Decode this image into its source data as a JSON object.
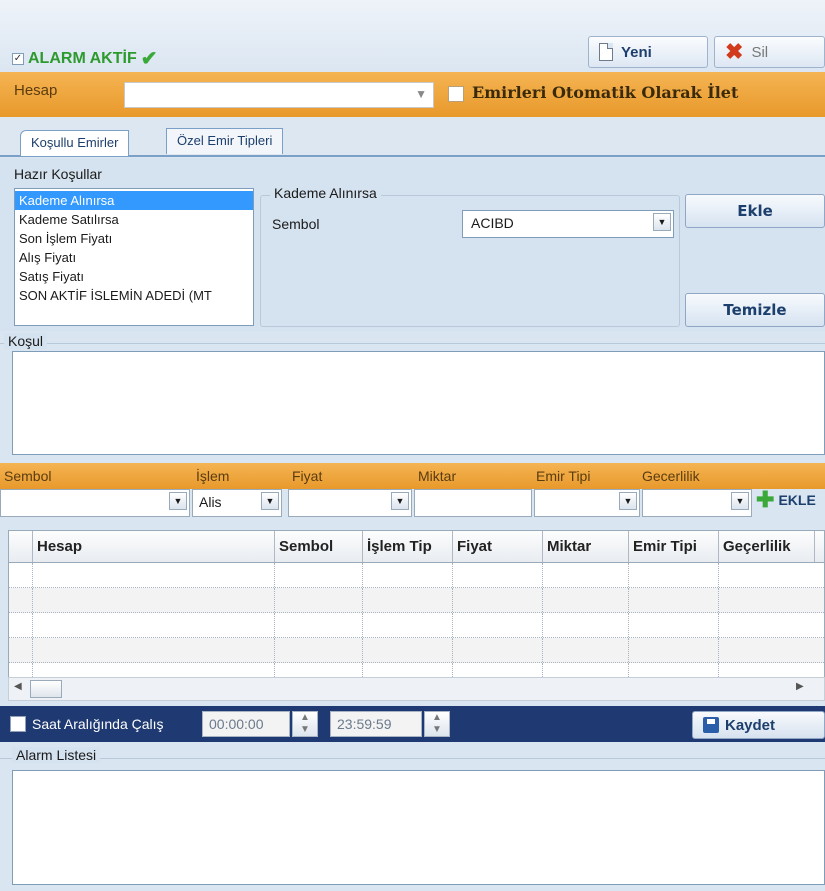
{
  "header": {
    "alarm_check": "✓",
    "alarm_label": "ALARM AKTİF",
    "alarm_tick": "✔",
    "new_label": "Yeni",
    "delete_label": "Sil"
  },
  "account": {
    "label": "Hesap",
    "value": "",
    "auto_send_label": "Emirleri Otomatik Olarak İlet"
  },
  "tabs": [
    {
      "label": "Koşullu Emirler"
    },
    {
      "label": "Özel Emir Tipleri"
    }
  ],
  "conditions": {
    "title": "Hazır Koşullar",
    "items": [
      {
        "label": "Kademe Alınırsa"
      },
      {
        "label": "Kademe Satılırsa"
      },
      {
        "label": "Son İşlem Fiyatı"
      },
      {
        "label": "Alış Fiyatı"
      },
      {
        "label": "Satış Fiyatı"
      },
      {
        "label": "SON AKTİF İSLEMİN ADEDİ (MT"
      }
    ],
    "group_title": "Kademe Alınırsa",
    "symbol_label": "Sembol",
    "symbol_value": "ACIBD",
    "add_label": "Ekle",
    "clear_label": "Temizle"
  },
  "condition_box": {
    "label": "Koşul"
  },
  "order": {
    "labels": [
      "Sembol",
      "İşlem",
      "Fiyat",
      "Miktar",
      "Emir Tipi",
      "Gecerlilik"
    ],
    "islem_value": "Alis",
    "add_label": "EKLE"
  },
  "grid": {
    "columns": [
      "Hesap",
      "Sembol",
      "İşlem Tip",
      "Fiyat",
      "Miktar",
      "Emir Tipi",
      "Geçerlilik"
    ]
  },
  "time": {
    "label": "Saat Aralığında Çalış",
    "start": "00:00:00",
    "end": "23:59:59",
    "save_label": "Kaydet"
  },
  "alarm_list": {
    "label": "Alarm Listesi"
  }
}
